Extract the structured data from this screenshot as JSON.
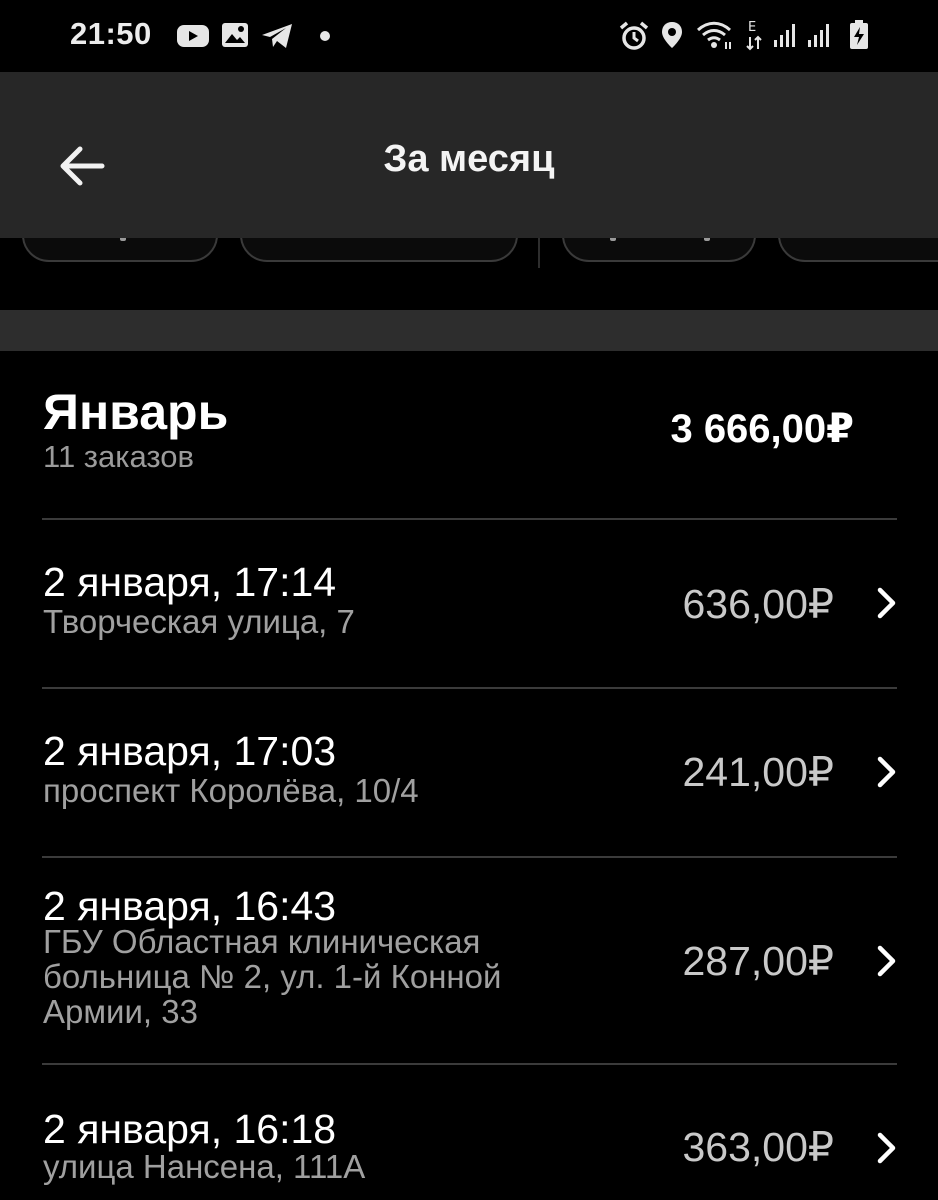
{
  "status_bar": {
    "time": "21:50",
    "left_icons": [
      "youtube-icon",
      "gallery-icon",
      "telegram-icon",
      "dot-icon"
    ],
    "right_icons": [
      "alarm-icon",
      "location-icon",
      "wifi-icon",
      "network-e-icon",
      "signal-1-icon",
      "signal-2-icon",
      "battery-charging-icon"
    ],
    "network_label": "E"
  },
  "app_bar": {
    "title": "За месяц",
    "back_icon": "arrow-left-icon"
  },
  "month": {
    "title": "Январь",
    "count": "11 заказов",
    "total": "3 666,00₽"
  },
  "orders": [
    {
      "date": "2 января, 17:14",
      "address": "Творческая улица, 7",
      "price": "636,00₽"
    },
    {
      "date": "2 января, 17:03",
      "address": "проспект Королёва, 10/4",
      "price": "241,00₽"
    },
    {
      "date": "2 января, 16:43",
      "address": "ГБУ Областная клиническая больница № 2, ул. 1-й Конной Армии, 33",
      "price": "287,00₽"
    },
    {
      "date": "2 января, 16:18",
      "address": "улица Нансена, 111А",
      "price": "363,00₽"
    }
  ],
  "colors": {
    "background": "#000000",
    "app_bar": "#272727",
    "secondary_text": "#a0a0a0",
    "divider": "#3b3b3b"
  }
}
